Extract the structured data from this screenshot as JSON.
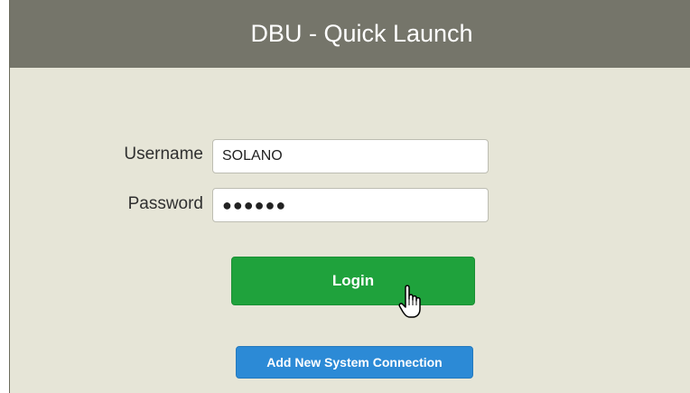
{
  "window": {
    "title": "DBU - Quick Launch"
  },
  "form": {
    "username_label": "Username",
    "username_value": "SOLANO",
    "password_label": "Password",
    "password_value": "●●●●●●"
  },
  "actions": {
    "login_label": "Login",
    "add_connection_label": "Add New System Connection"
  },
  "colors": {
    "titlebar": "#75756a",
    "background": "#e6e5d7",
    "login_button": "#1fa23c",
    "add_button": "#2c8ad6"
  },
  "icons": {
    "cursor": "hand-pointer-icon"
  }
}
